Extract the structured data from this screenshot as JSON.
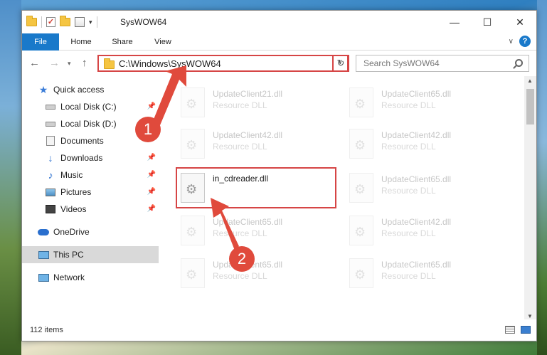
{
  "window": {
    "title": "SysWOW64"
  },
  "ribbon": {
    "tabs": [
      "File",
      "Home",
      "Share",
      "View"
    ],
    "help": "?"
  },
  "nav": {
    "address": "C:\\Windows\\SysWOW64",
    "search_placeholder": "Search SysWOW64"
  },
  "sidebar": {
    "items": [
      {
        "label": "Quick access",
        "icon": "star-icon",
        "pinned": false
      },
      {
        "label": "Local Disk (C:)",
        "icon": "disk-icon",
        "pinned": true
      },
      {
        "label": "Local Disk (D:)",
        "icon": "disk-icon",
        "pinned": false
      },
      {
        "label": "Documents",
        "icon": "documents-icon",
        "pinned": false
      },
      {
        "label": "Downloads",
        "icon": "download-icon",
        "pinned": true
      },
      {
        "label": "Music",
        "icon": "music-icon",
        "pinned": true
      },
      {
        "label": "Pictures",
        "icon": "pictures-icon",
        "pinned": true
      },
      {
        "label": "Videos",
        "icon": "videos-icon",
        "pinned": true
      },
      {
        "label": "OneDrive",
        "icon": "onedrive-icon",
        "pinned": false
      },
      {
        "label": "This PC",
        "icon": "this-pc-icon",
        "pinned": false,
        "selected": true
      },
      {
        "label": "Network",
        "icon": "network-icon",
        "pinned": false
      }
    ]
  },
  "files": [
    {
      "name": "UpdateClient21.dll",
      "type": "Resource DLL",
      "faded": true
    },
    {
      "name": "UpdateClient65.dll",
      "type": "Resource DLL",
      "faded": true
    },
    {
      "name": "UpdateClient42.dll",
      "type": "Resource DLL",
      "faded": true
    },
    {
      "name": "UpdateClient42.dll",
      "type": "Resource DLL",
      "faded": true
    },
    {
      "name": "in_cdreader.dll",
      "type": "",
      "faded": false,
      "highlighted": true
    },
    {
      "name": "UpdateClient65.dll",
      "type": "Resource DLL",
      "faded": true
    },
    {
      "name": "UpdateClient65.dll",
      "type": "Resource DLL",
      "faded": true
    },
    {
      "name": "UpdateClient42.dll",
      "type": "Resource DLL",
      "faded": true
    },
    {
      "name": "UpdateClient65.dll",
      "type": "Resource DLL",
      "faded": true
    },
    {
      "name": "UpdateClient65.dll",
      "type": "Resource DLL",
      "faded": true
    }
  ],
  "status": {
    "item_count": "112 items"
  },
  "annotations": {
    "step1": "1",
    "step2": "2"
  },
  "colors": {
    "accent": "#1979ca",
    "highlight": "#d64545",
    "badge": "#e04a3c"
  }
}
